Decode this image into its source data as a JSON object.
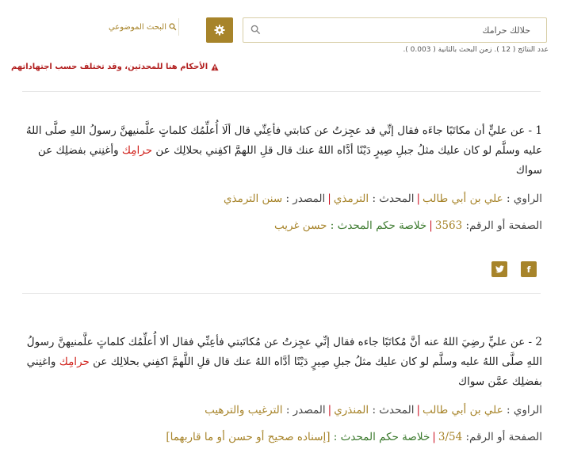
{
  "search": {
    "value": "حلالك حرامك",
    "placeholder": ""
  },
  "topic_search": {
    "label": "البحث الموضوعي"
  },
  "stats": {
    "text": "عدد النتائج ( 12 ). زمن البحث بالثانية ( 0.003 )."
  },
  "warning": {
    "text": "الأحكام هنا للمحدثين، وقد تختلف حسب اجتهاداتهم"
  },
  "results": [
    {
      "number": "1",
      "before": "1 - عن عليٍّ أن مكاتَبًا جاءَه فقال إنِّي قد عجِزتُ عن كتابتي فأعِنِّي قال ألَا أُعلِّمُك كلماتٍ علَّمنيهنَّ رسولُ اللهِ صلَّى اللهُ عليه وسلَّم لو كان عليك مثلُ جبلِ صِيرٍ دَيْنًا أدَّاه اللهُ عنك قال قلِ اللهمَّ اكفِني بحلالِك عن ",
      "highlight": "حرامِك",
      "after": " وأغنِني بفضلِك عن سواك",
      "narrator_label": "الراوي :",
      "narrator": "علي بن أبي طالب",
      "muhaddith_label": "المحدث :",
      "muhaddith": "الترمذي",
      "source_label": "المصدر :",
      "source": "سنن الترمذي",
      "page_label": "الصفحة أو الرقم:",
      "page": "3563",
      "ruling_label": "خلاصة حكم المحدث :",
      "ruling": "حسن غريب"
    },
    {
      "number": "2",
      "before": "2 - عن عليٍّ رضِيَ اللهُ عنه أنَّ مُكاتَبًا جاءه فقال إنِّي عجِزتُ عن مُكاتَبتي فأعِنِّي فقال ألا أُعلِّمُك كلماتٍ علَّمنيهنَّ رسولُ اللهِ صلَّى اللهُ عليه وسلَّم لو كان عليك مثلُ جبلِ صِيرٍ دَيْنًا أدَّاه اللهُ عنك قال قلِ اللَّهمَّ اكفِني بحلالِك عن ",
      "highlight": "حرامِك",
      "after": " واغنِني بفضلِك عمَّن سواك",
      "narrator_label": "الراوي :",
      "narrator": "علي بن أبي طالب",
      "muhaddith_label": "المحدث :",
      "muhaddith": "المنذري",
      "source_label": "المصدر :",
      "source": "الترغيب والترهيب",
      "page_label": "الصفحة أو الرقم:",
      "page": "3/54",
      "ruling_label": "خلاصة حكم المحدث :",
      "ruling": "[إسناده صحيح أو حسن أو ما قاربهما]"
    }
  ],
  "share": {
    "facebook": "f",
    "twitter": "t"
  },
  "colors": {
    "accent": "#a7842a",
    "warning": "#b22020",
    "highlight": "#d0201a",
    "ruling": "#3c7a2e"
  }
}
